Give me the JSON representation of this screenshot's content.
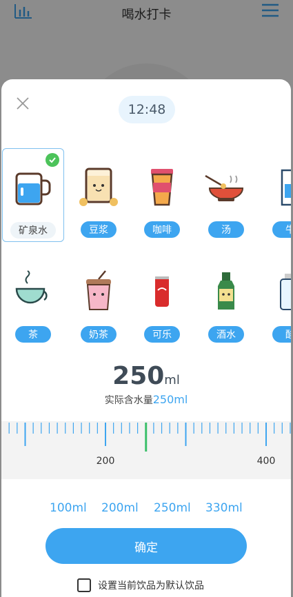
{
  "app": {
    "title": "喝水打卡"
  },
  "sheet": {
    "time": "12:48",
    "drinks": [
      {
        "label": "矿泉水",
        "icon": "water-glass-icon",
        "selected": true
      },
      {
        "label": "豆浆",
        "icon": "soy-milk-icon",
        "selected": false
      },
      {
        "label": "咖啡",
        "icon": "coffee-cup-icon",
        "selected": false
      },
      {
        "label": "汤",
        "icon": "soup-bowl-icon",
        "selected": false
      },
      {
        "label": "牛",
        "icon": "milk-carton-icon",
        "selected": false
      },
      {
        "label": "茶",
        "icon": "tea-cup-icon",
        "selected": false
      },
      {
        "label": "奶茶",
        "icon": "milk-tea-icon",
        "selected": false
      },
      {
        "label": "可乐",
        "icon": "cola-can-icon",
        "selected": false
      },
      {
        "label": "酒水",
        "icon": "liquor-bottle-icon",
        "selected": false
      },
      {
        "label": "酸",
        "icon": "yogurt-bottle-icon",
        "selected": false
      }
    ],
    "amount": {
      "value": "250",
      "unit": "ml"
    },
    "actual": {
      "prefix": "实际含水量",
      "value": "250ml"
    },
    "ruler": {
      "labels": [
        "200",
        "400"
      ],
      "current": 250
    },
    "quick_amounts": [
      "100ml",
      "200ml",
      "250ml",
      "330ml"
    ],
    "confirm_label": "确定",
    "default_label": "设置当前饮品为默认饮品"
  },
  "colors": {
    "accent": "#3da5f0",
    "check": "#4cc35a"
  }
}
